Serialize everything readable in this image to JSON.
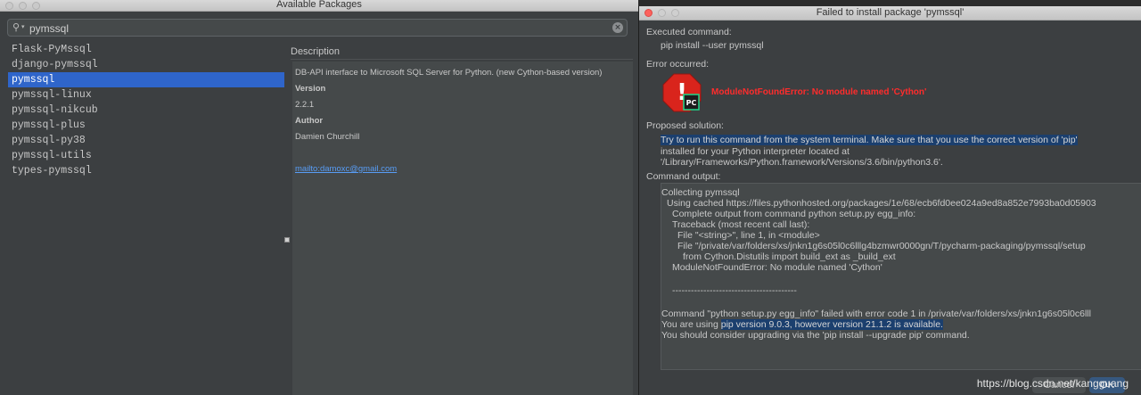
{
  "left_window": {
    "title": "Available Packages",
    "search": {
      "value": "pymssql"
    },
    "packages": [
      "Flask-PyMssql",
      "django-pymssql",
      "pymssql",
      "pymssql-linux",
      "pymssql-nikcub",
      "pymssql-plus",
      "pymssql-py38",
      "pymssql-utils",
      "types-pymssql"
    ],
    "selected_package": "pymssql",
    "description": {
      "header": "Description",
      "summary": "DB-API interface to Microsoft SQL Server for Python. (new Cython-based version)",
      "version_label": "Version",
      "version": "2.2.1",
      "author_label": "Author",
      "author": "Damien Churchill",
      "email_link": "mailto:damoxc@gmail.com"
    }
  },
  "dialog": {
    "title": "Failed to install package 'pymssql'",
    "executed_label": "Executed command:",
    "executed_command": "pip install --user pymssql",
    "error_label": "Error occurred:",
    "error_message": "ModuleNotFoundError: No module named 'Cython'",
    "solution_label": "Proposed solution:",
    "solution_lines": [
      "Try to run this command from the system terminal. Make sure that you use the correct version of 'pip'",
      "installed for your Python interpreter located at",
      "'/Library/Frameworks/Python.framework/Versions/3.6/bin/python3.6'."
    ],
    "output_label": "Command output:",
    "output_lines": [
      "Collecting pymssql",
      "  Using cached https://files.pythonhosted.org/packages/1e/68/ecb6fd0ee024a9ed8a852e7993ba0d05903",
      "    Complete output from command python setup.py egg_info:",
      "    Traceback (most recent call last):",
      "      File \"<string>\", line 1, in <module>",
      "      File \"/private/var/folders/xs/jnkn1g6s05l0c6lllg4bzmwr0000gn/T/pycharm-packaging/pymssql/setup",
      "        from Cython.Distutils import build_ext as _build_ext",
      "    ModuleNotFoundError: No module named 'Cython'",
      "",
      "    ----------------------------------------",
      "",
      "Command \"python setup.py egg_info\" failed with error code 1 in /private/var/folders/xs/jnkn1g6s05l0c6lll",
      "You are using pip version 9.0.3, however version 21.1.2 is available.",
      "You should consider upgrading via the 'pip install --upgrade pip' command."
    ],
    "pip_warning_prefix": "You are using ",
    "pip_warning_highlight": "pip version 9.0.3, however version 21.1.2 is available.",
    "cancel_label": "Cancel",
    "ok_label": "OK"
  },
  "watermark": "https://blog.csdn.net/kangguang"
}
